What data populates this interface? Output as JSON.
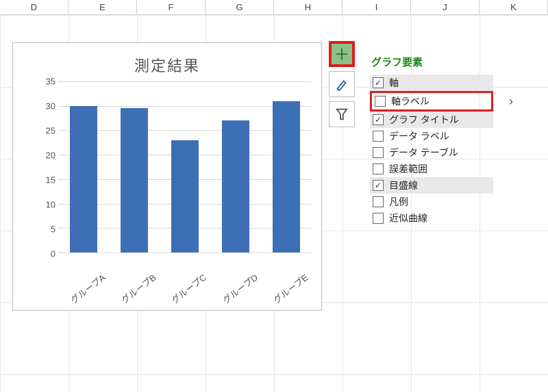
{
  "columns": [
    "D",
    "E",
    "F",
    "G",
    "H",
    "I",
    "J",
    "K"
  ],
  "chart_data": {
    "type": "bar",
    "title": "測定結果",
    "categories": [
      "グループA",
      "グループB",
      "グループC",
      "グループD",
      "グループE"
    ],
    "values": [
      30,
      29.5,
      23,
      27,
      31
    ],
    "yticks": [
      0,
      5,
      10,
      15,
      20,
      25,
      30,
      35
    ],
    "ylim": [
      0,
      35
    ],
    "xlabel": "",
    "ylabel": ""
  },
  "popup": {
    "title": "グラフ要素",
    "items": [
      {
        "label": "軸",
        "checked": true,
        "hover": true
      },
      {
        "label": "軸ラベル",
        "checked": false,
        "hover": false,
        "highlight": true,
        "arrow": true
      },
      {
        "label": "グラフ タイトル",
        "checked": true,
        "hover": true
      },
      {
        "label": "データ ラベル",
        "checked": false,
        "hover": false
      },
      {
        "label": "データ テーブル",
        "checked": false,
        "hover": false
      },
      {
        "label": "誤差範囲",
        "checked": false,
        "hover": false
      },
      {
        "label": "目盛線",
        "checked": true,
        "hover": true
      },
      {
        "label": "凡例",
        "checked": false,
        "hover": false
      },
      {
        "label": "近似曲線",
        "checked": false,
        "hover": false
      }
    ]
  }
}
